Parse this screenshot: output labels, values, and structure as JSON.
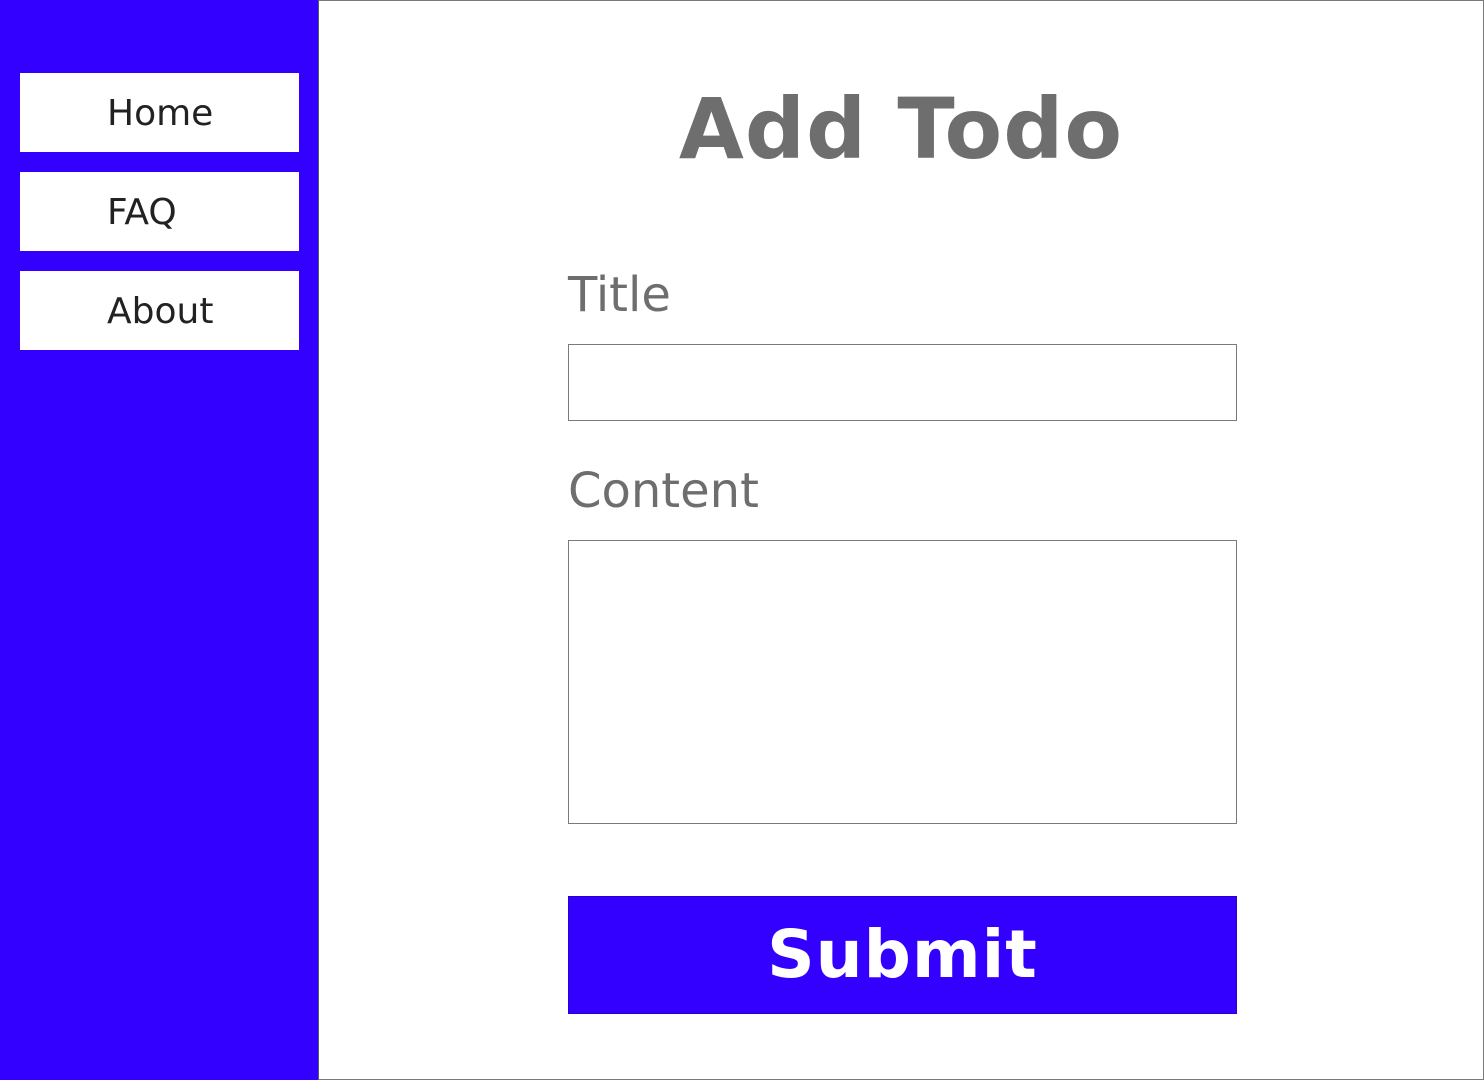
{
  "colors": {
    "accent": "#3300ff",
    "heading_text": "#6e6e6e",
    "nav_text": "#222222",
    "background": "#ffffff",
    "border": "#7a7a7a"
  },
  "sidebar": {
    "items": [
      {
        "label": "Home"
      },
      {
        "label": "FAQ"
      },
      {
        "label": "About"
      }
    ]
  },
  "main": {
    "title": "Add Todo",
    "form": {
      "title_label": "Title",
      "title_value": "",
      "content_label": "Content",
      "content_value": "",
      "submit_label": "Submit"
    }
  }
}
